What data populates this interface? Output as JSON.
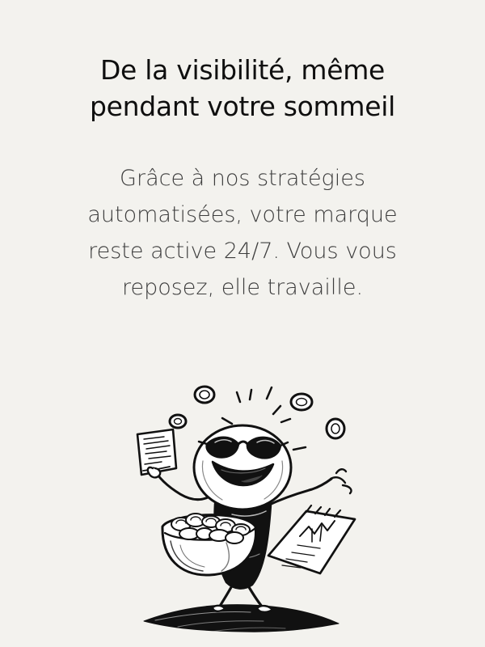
{
  "hero": {
    "title_lines": [
      "De la visibilité, même",
      "pendant votre sommeil"
    ],
    "description_lines": [
      "Grâce à nos stratégies",
      "automatisées, votre marque",
      "reste active 24/7. Vous vous",
      "reposez, elle travaille."
    ]
  },
  "illustration": {
    "subject": "cartoon-character-with-sunglasses-holding-coin-bowl-and-documents",
    "ink_color": "#111111",
    "background_color": "#f3f2ee"
  }
}
